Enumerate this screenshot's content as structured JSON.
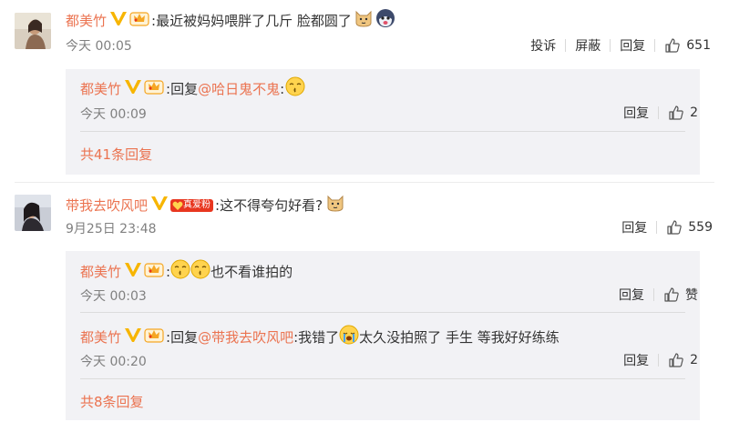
{
  "comments": [
    {
      "user": "都美竹",
      "text": "最近被妈妈喂胖了几斤 脸都圆了",
      "time": "今天 00:05",
      "actions": [
        "投诉",
        "屏蔽",
        "回复"
      ],
      "likes": "651",
      "replies": [
        {
          "user": "都美竹",
          "prefix": "回复",
          "mention": "@哈日鬼不鬼",
          "text": ":",
          "time": "今天 00:09",
          "action": "回复",
          "likes": "2"
        }
      ],
      "more": "共41条回复"
    },
    {
      "user": "带我去吹风吧",
      "badge": "真爱粉",
      "text": ":这不得夸句好看?",
      "time": "9月25日 23:48",
      "action": "回复",
      "likes": "559",
      "replies": [
        {
          "user": "都美竹",
          "text": "也不看谁拍的",
          "time": "今天 00:03",
          "action": "回复",
          "likes": "赞"
        },
        {
          "user": "都美竹",
          "prefix": "回复",
          "mention": "@带我去吹风吧",
          "text": ":我错了",
          "text2": "太久没拍照了 手生 等我好好练练",
          "time": "今天 00:20",
          "action": "回复",
          "likes": "2"
        }
      ],
      "more": "共8条回复"
    }
  ],
  "colors": {
    "username": "#eb7350",
    "reply_bg": "#f2f2f5",
    "time": "#808080"
  },
  "icons": [
    "verified-v-icon",
    "crown-badge-icon",
    "cat-emoji-icon",
    "husky-emoji-icon",
    "kiss-emoji-icon",
    "cry-emoji-icon",
    "thumbs-up-icon"
  ]
}
